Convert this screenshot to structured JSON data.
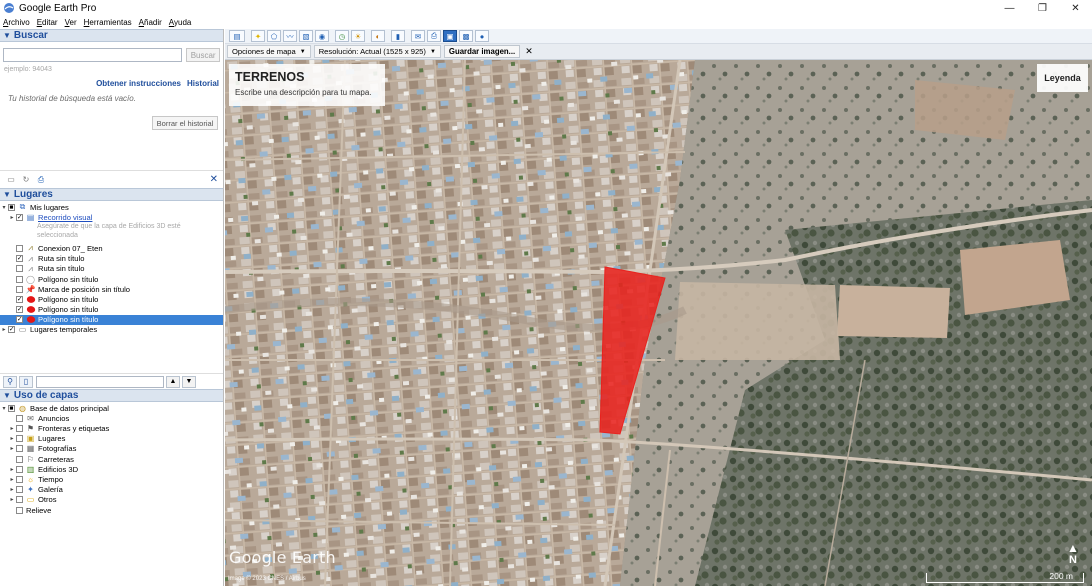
{
  "window": {
    "title": "Google Earth Pro",
    "controls": [
      "—",
      "❐",
      "✕"
    ]
  },
  "menu": [
    "Archivo",
    "Editar",
    "Ver",
    "Herramientas",
    "Añadir",
    "Ayuda"
  ],
  "search": {
    "header": "Buscar",
    "placeholder": "",
    "button": "Buscar",
    "hint": "ejemplo: 94043",
    "link_instructions": "Obtener instrucciones",
    "link_history": "Historial",
    "history_empty": "Tu historial de búsqueda está vacío.",
    "clear_history": "Borrar el historial"
  },
  "places": {
    "header": "Lugares",
    "items": [
      {
        "label": "Mis lugares"
      },
      {
        "label": "Recorrido visual",
        "note": "Asegúrate de que la capa de Edificios 3D esté seleccionada"
      },
      {
        "label": "Conexion 07_ Eten"
      },
      {
        "label": "Ruta sin título"
      },
      {
        "label": "Ruta sin título"
      },
      {
        "label": "Polígono sin título"
      },
      {
        "label": "Marca de posición sin título"
      },
      {
        "label": "Polígono sin título"
      },
      {
        "label": "Polígono sin título"
      },
      {
        "label": "Polígono sin título"
      },
      {
        "label": "Lugares temporales"
      }
    ]
  },
  "layers": {
    "header": "Uso de capas",
    "items": [
      {
        "label": "Base de datos principal"
      },
      {
        "label": "Anuncios"
      },
      {
        "label": "Fronteras y etiquetas"
      },
      {
        "label": "Lugares"
      },
      {
        "label": "Fotografías"
      },
      {
        "label": "Carreteras"
      },
      {
        "label": "Edificios 3D"
      },
      {
        "label": "Tiempo"
      },
      {
        "label": "Galería"
      },
      {
        "label": "Otros"
      },
      {
        "label": "Relieve"
      }
    ]
  },
  "print_toolbar": {
    "map_options": "Opciones de mapa",
    "resolution": "Resolución: Actual (1525 x 925)",
    "save_image": "Guardar imagen...",
    "close": "✕"
  },
  "map": {
    "title": "TERRENOS",
    "description": "Escribe una descripción para tu mapa.",
    "legend": "Leyenda",
    "logo": "Google Earth",
    "credit": "Image © 2023 CNES / Airbus",
    "north": "N",
    "scale": "200 m",
    "polygon_color": "#e8231f"
  }
}
